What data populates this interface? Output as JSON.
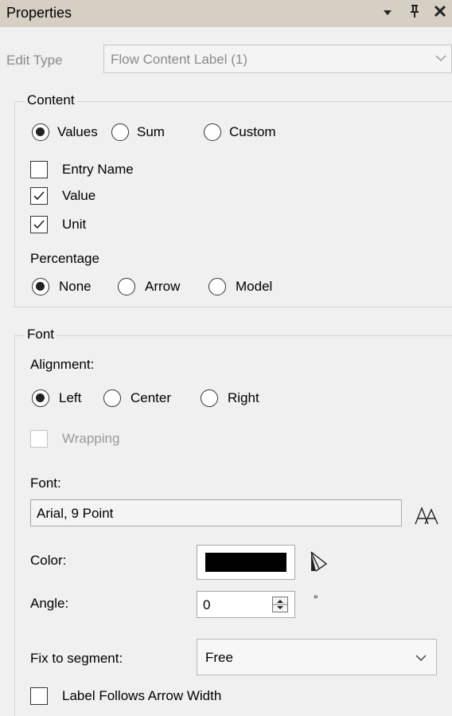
{
  "panel": {
    "title": "Properties"
  },
  "edit_type": {
    "label": "Edit Type",
    "value": "Flow Content Label (1)"
  },
  "content": {
    "legend": "Content",
    "mode_options": [
      "Values",
      "Sum",
      "Custom"
    ],
    "checks": [
      {
        "label": "Entry Name",
        "checked": false
      },
      {
        "label": "Value",
        "checked": true
      },
      {
        "label": "Unit",
        "checked": true
      }
    ],
    "percentage_label": "Percentage",
    "percentage_options": [
      "None",
      "Arrow",
      "Model"
    ]
  },
  "font_group": {
    "legend": "Font",
    "alignment_label": "Alignment:",
    "alignment_options": [
      "Left",
      "Center",
      "Right"
    ],
    "wrapping_label": "Wrapping",
    "font_label": "Font:",
    "font_value": "Arial, 9 Point",
    "color_label": "Color:",
    "color_value": "#000000",
    "angle_label": "Angle:",
    "angle_value": "0",
    "angle_unit": "°",
    "segment_label": "Fix to segment:",
    "segment_value": "Free",
    "arrow_width_label": "Label Follows Arrow Width"
  }
}
